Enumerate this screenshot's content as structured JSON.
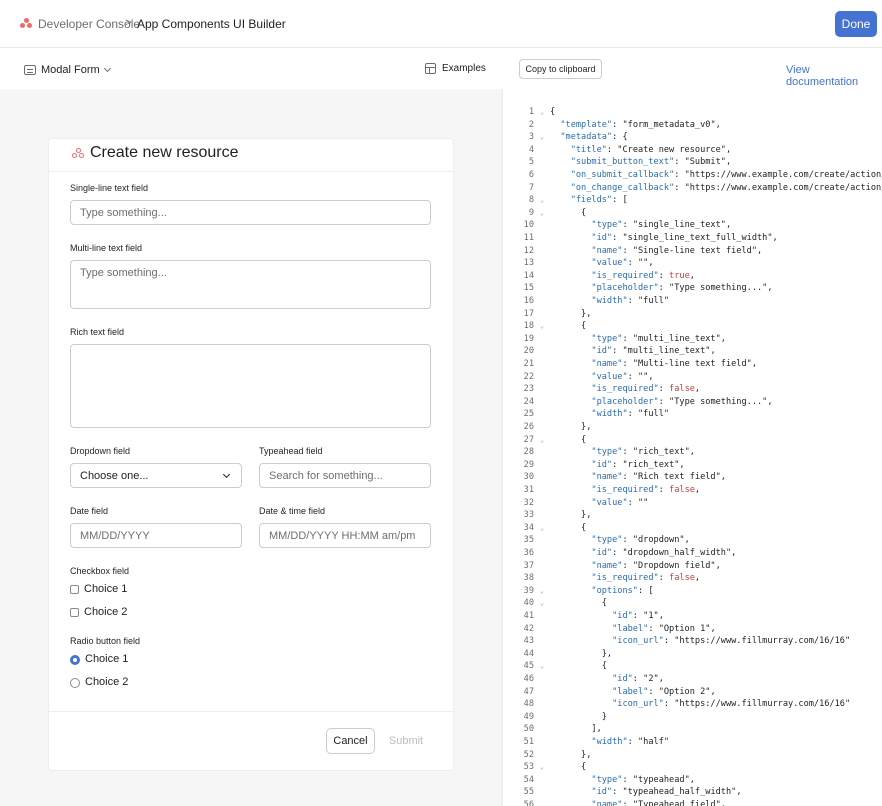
{
  "header": {
    "breadcrumb_root": "Developer Console",
    "breadcrumb_separator": ">",
    "breadcrumb_current": "App Components UI Builder",
    "done_label": "Done"
  },
  "toolbar": {
    "form_select_label": "Modal Form",
    "examples_label": "Examples",
    "copy_label": "Copy to clipboard",
    "view_doc_label": "View documentation"
  },
  "form": {
    "title": "Create new resource",
    "single_line": {
      "label": "Single-line text field",
      "placeholder": "Type something..."
    },
    "multi_line": {
      "label": "Multi-line text field",
      "placeholder": "Type something..."
    },
    "rich_text": {
      "label": "Rich text field"
    },
    "dropdown": {
      "label": "Dropdown field",
      "value": "Choose one..."
    },
    "typeahead": {
      "label": "Typeahead field",
      "placeholder": "Search for something..."
    },
    "date": {
      "label": "Date field",
      "placeholder": "MM/DD/YYYY"
    },
    "datetime": {
      "label": "Date & time field",
      "placeholder": "MM/DD/YYYY HH:MM am/pm"
    },
    "checkbox": {
      "label": "Checkbox field",
      "options": [
        "Choice 1",
        "Choice 2"
      ]
    },
    "radio": {
      "label": "Radio button field",
      "options": [
        "Choice 1",
        "Choice 2"
      ],
      "selected_index": 0
    },
    "cancel_label": "Cancel",
    "submit_label": "Submit"
  },
  "code": {
    "lines": [
      {
        "n": "1",
        "fold": true,
        "t": "{"
      },
      {
        "n": "2",
        "fold": false,
        "t": "  \"template\": \"form_metadata_v0\","
      },
      {
        "n": "3",
        "fold": true,
        "t": "  \"metadata\": {"
      },
      {
        "n": "4",
        "fold": false,
        "t": "    \"title\": \"Create new resource\","
      },
      {
        "n": "5",
        "fold": false,
        "t": "    \"submit_button_text\": \"Submit\","
      },
      {
        "n": "6",
        "fold": false,
        "t": "    \"on_submit_callback\": \"https://www.example.com/create/action/"
      },
      {
        "n": "7",
        "fold": false,
        "t": "    \"on_change_callback\": \"https://www.example.com/create/action/"
      },
      {
        "n": "8",
        "fold": true,
        "t": "    \"fields\": ["
      },
      {
        "n": "9",
        "fold": true,
        "t": "      {"
      },
      {
        "n": "10",
        "fold": false,
        "t": "        \"type\": \"single_line_text\","
      },
      {
        "n": "11",
        "fold": false,
        "t": "        \"id\": \"single_line_text_full_width\","
      },
      {
        "n": "12",
        "fold": false,
        "t": "        \"name\": \"Single-line text field\","
      },
      {
        "n": "13",
        "fold": false,
        "t": "        \"value\": \"\","
      },
      {
        "n": "14",
        "fold": false,
        "t": "        \"is_required\": true,"
      },
      {
        "n": "15",
        "fold": false,
        "t": "        \"placeholder\": \"Type something...\","
      },
      {
        "n": "16",
        "fold": false,
        "t": "        \"width\": \"full\""
      },
      {
        "n": "17",
        "fold": false,
        "t": "      },"
      },
      {
        "n": "18",
        "fold": true,
        "t": "      {"
      },
      {
        "n": "19",
        "fold": false,
        "t": "        \"type\": \"multi_line_text\","
      },
      {
        "n": "20",
        "fold": false,
        "t": "        \"id\": \"multi_line_text\","
      },
      {
        "n": "21",
        "fold": false,
        "t": "        \"name\": \"Multi-line text field\","
      },
      {
        "n": "22",
        "fold": false,
        "t": "        \"value\": \"\","
      },
      {
        "n": "23",
        "fold": false,
        "t": "        \"is_required\": false,"
      },
      {
        "n": "24",
        "fold": false,
        "t": "        \"placeholder\": \"Type something...\","
      },
      {
        "n": "25",
        "fold": false,
        "t": "        \"width\": \"full\""
      },
      {
        "n": "26",
        "fold": false,
        "t": "      },"
      },
      {
        "n": "27",
        "fold": true,
        "t": "      {"
      },
      {
        "n": "28",
        "fold": false,
        "t": "        \"type\": \"rich_text\","
      },
      {
        "n": "29",
        "fold": false,
        "t": "        \"id\": \"rich_text\","
      },
      {
        "n": "30",
        "fold": false,
        "t": "        \"name\": \"Rich text field\","
      },
      {
        "n": "31",
        "fold": false,
        "t": "        \"is_required\": false,"
      },
      {
        "n": "32",
        "fold": false,
        "t": "        \"value\": \"\""
      },
      {
        "n": "33",
        "fold": false,
        "t": "      },"
      },
      {
        "n": "34",
        "fold": true,
        "t": "      {"
      },
      {
        "n": "35",
        "fold": false,
        "t": "        \"type\": \"dropdown\","
      },
      {
        "n": "36",
        "fold": false,
        "t": "        \"id\": \"dropdown_half_width\","
      },
      {
        "n": "37",
        "fold": false,
        "t": "        \"name\": \"Dropdown field\","
      },
      {
        "n": "38",
        "fold": false,
        "t": "        \"is_required\": false,"
      },
      {
        "n": "39",
        "fold": true,
        "t": "        \"options\": ["
      },
      {
        "n": "40",
        "fold": true,
        "t": "          {"
      },
      {
        "n": "41",
        "fold": false,
        "t": "            \"id\": \"1\","
      },
      {
        "n": "42",
        "fold": false,
        "t": "            \"label\": \"Option 1\","
      },
      {
        "n": "43",
        "fold": false,
        "t": "            \"icon_url\": \"https://www.fillmurray.com/16/16\""
      },
      {
        "n": "44",
        "fold": false,
        "t": "          },"
      },
      {
        "n": "45",
        "fold": true,
        "t": "          {"
      },
      {
        "n": "46",
        "fold": false,
        "t": "            \"id\": \"2\","
      },
      {
        "n": "47",
        "fold": false,
        "t": "            \"label\": \"Option 2\","
      },
      {
        "n": "48",
        "fold": false,
        "t": "            \"icon_url\": \"https://www.fillmurray.com/16/16\""
      },
      {
        "n": "49",
        "fold": false,
        "t": "          }"
      },
      {
        "n": "50",
        "fold": false,
        "t": "        ],"
      },
      {
        "n": "51",
        "fold": false,
        "t": "        \"width\": \"half\""
      },
      {
        "n": "52",
        "fold": false,
        "t": "      },"
      },
      {
        "n": "53",
        "fold": true,
        "t": "      {"
      },
      {
        "n": "54",
        "fold": false,
        "t": "        \"type\": \"typeahead\","
      },
      {
        "n": "55",
        "fold": false,
        "t": "        \"id\": \"typeahead_half_width\","
      },
      {
        "n": "56",
        "fold": false,
        "t": "        \"name\": \"Typeahead field\","
      }
    ]
  },
  "colors": {
    "accent": "#4573d2",
    "brand": "#f06a6a",
    "json_key": "#296bb6",
    "json_bool": "#c43e3e"
  }
}
